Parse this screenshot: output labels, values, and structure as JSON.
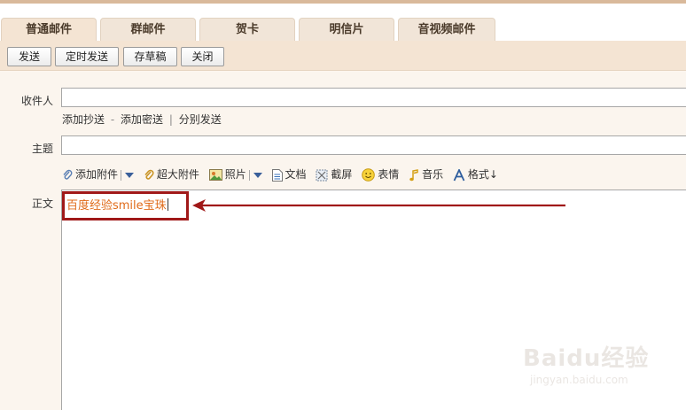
{
  "tabs": [
    {
      "label": "普通邮件",
      "active": true
    },
    {
      "label": "群邮件"
    },
    {
      "label": "贺卡"
    },
    {
      "label": "明信片"
    },
    {
      "label": "音视频邮件"
    }
  ],
  "toolbar": {
    "send": "发送",
    "scheduled_send": "定时发送",
    "save_draft": "存草稿",
    "close": "关闭"
  },
  "compose": {
    "to_label": "收件人",
    "to_value": "",
    "add_cc": "添加抄送",
    "dash": "-",
    "add_bcc": "添加密送",
    "bar": "|",
    "separate_send": "分别发送",
    "subject_label": "主题",
    "subject_value": "",
    "body_label": "正文",
    "body_text": "百度经验smile宝珠"
  },
  "attach_bar": {
    "add_attachment": "添加附件",
    "large_attachment": "超大附件",
    "photo": "照片",
    "document": "文档",
    "screenshot": "截屏",
    "emoticon": "表情",
    "music": "音乐",
    "format": "格式↓"
  },
  "watermark": {
    "logo": "Baidu经验",
    "url": "jingyan.baidu.com"
  },
  "colors": {
    "tab_bg": "#f1e5d8",
    "toolbar_bg": "#f4e4d3",
    "highlight": "#a01818",
    "body_text": "#e06b1a"
  }
}
